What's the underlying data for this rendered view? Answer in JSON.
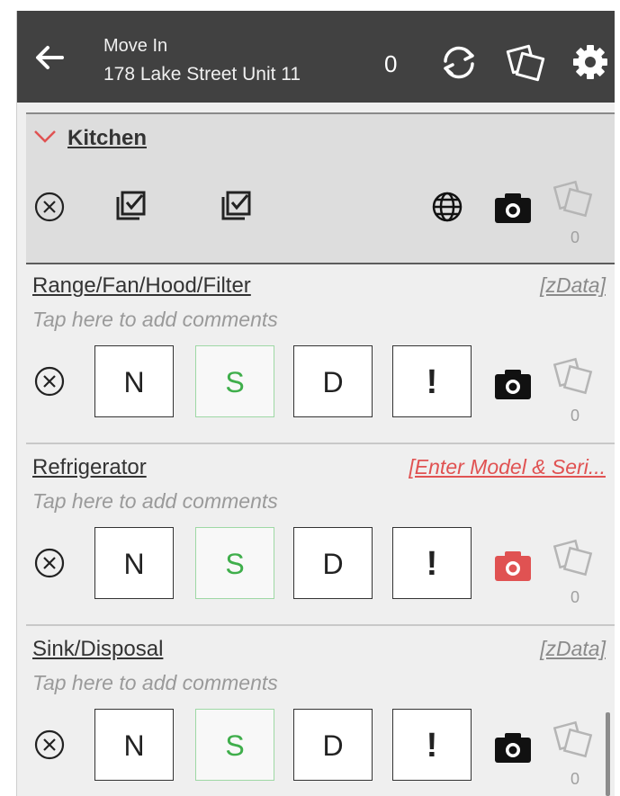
{
  "header": {
    "title": "Move In",
    "address": "178 Lake Street Unit 11",
    "count": "0"
  },
  "section": {
    "name": "Kitchen",
    "photo_count": "0"
  },
  "items": [
    {
      "name": "Range/Fan/Hood/Filter",
      "link": "[zData]",
      "comment_placeholder": "Tap here to add comments",
      "btn_n": "N",
      "btn_s": "S",
      "btn_d": "D",
      "btn_ex": "!",
      "photo_count": "0"
    },
    {
      "name": "Refrigerator",
      "link": "[Enter Model & Seri...",
      "comment_placeholder": "Tap here to add comments",
      "btn_n": "N",
      "btn_s": "S",
      "btn_d": "D",
      "btn_ex": "!",
      "photo_count": "0"
    },
    {
      "name": "Sink/Disposal",
      "link": "[zData]",
      "comment_placeholder": "Tap here to add comments",
      "btn_n": "N",
      "btn_s": "S",
      "btn_d": "D",
      "btn_ex": "!",
      "photo_count": "0"
    }
  ],
  "colors": {
    "header_bg": "#414141",
    "selected_green": "#3fae4b",
    "alert_red": "#e05252"
  },
  "icons": [
    "back-arrow-icon",
    "sync-icon",
    "photos-icon",
    "gear-icon",
    "chevron-down-icon",
    "clear-icon",
    "check-all-icon",
    "globe-icon",
    "camera-icon"
  ]
}
